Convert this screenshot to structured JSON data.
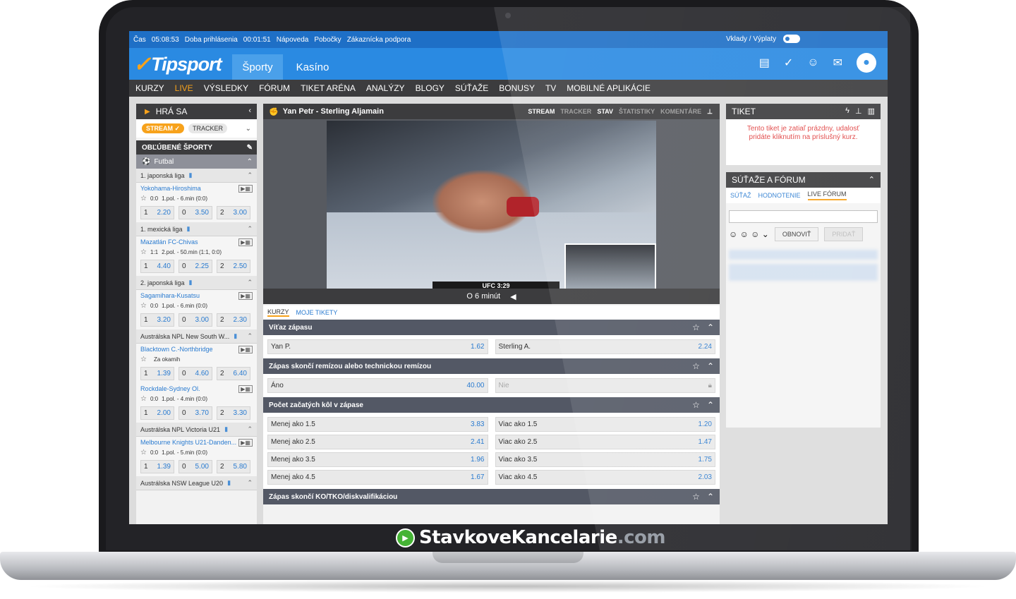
{
  "topbar": {
    "time_label": "Čas",
    "time": "05:08:53",
    "login_label": "Doba prihlásenia",
    "login_time": "00:01:51",
    "links": [
      "Nápoveda",
      "Pobočky",
      "Zákaznícka podpora"
    ],
    "deposits": "Vklady / Výplaty"
  },
  "header": {
    "logo": "Tipsport",
    "tabs": [
      "Športy",
      "Kasíno"
    ]
  },
  "nav": [
    "KURZY",
    "LIVE",
    "VÝSLEDKY",
    "FÓRUM",
    "TIKET ARÉNA",
    "ANALÝZY",
    "BLOGY",
    "SÚŤAŽE",
    "BONUSY",
    "TV",
    "MOBILNÉ APLIKÁCIE"
  ],
  "left": {
    "title": "HRÁ SA",
    "stream": "STREAM",
    "tracker": "TRACKER",
    "favorites": "OBĽÚBENÉ ŠPORTY",
    "sport": "Futbal",
    "leagues": [
      {
        "name": "1. japonská liga",
        "matches": [
          {
            "name": "Yokohama-Hiroshima",
            "score": "0:0",
            "status": "1.pol. - 6.min (0:0)",
            "odds": [
              [
                "1",
                "2.20"
              ],
              [
                "0",
                "3.50"
              ],
              [
                "2",
                "3.00"
              ]
            ]
          }
        ]
      },
      {
        "name": "1. mexická liga",
        "matches": [
          {
            "name": "Mazatlán FC-Chivas",
            "score": "1:1",
            "status": "2.pol. - 50.min (1:1, 0:0)",
            "odds": [
              [
                "1",
                "4.40"
              ],
              [
                "0",
                "2.25"
              ],
              [
                "2",
                "2.50"
              ]
            ]
          }
        ]
      },
      {
        "name": "2. japonská liga",
        "matches": [
          {
            "name": "Sagamihara-Kusatsu",
            "score": "0:0",
            "status": "1.pol. - 6.min (0:0)",
            "odds": [
              [
                "1",
                "3.20"
              ],
              [
                "0",
                "3.00"
              ],
              [
                "2",
                "2.30"
              ]
            ]
          }
        ]
      },
      {
        "name": "Austrálska NPL New South W...",
        "matches": [
          {
            "name": "Blacktown C.-Northbridge",
            "score": "",
            "status": "Za okamih",
            "odds": [
              [
                "1",
                "1.39"
              ],
              [
                "0",
                "4.60"
              ],
              [
                "2",
                "6.40"
              ]
            ]
          },
          {
            "name": "Rockdale-Sydney Ol.",
            "score": "0:0",
            "status": "1.pol. - 4.min (0:0)",
            "odds": [
              [
                "1",
                "2.00"
              ],
              [
                "0",
                "3.70"
              ],
              [
                "2",
                "3.30"
              ]
            ]
          }
        ]
      },
      {
        "name": "Austrálska NPL Victoria U21",
        "matches": [
          {
            "name": "Melbourne Knights U21-Danden...",
            "score": "0:0",
            "status": "1.pol. - 5.min (0:0)",
            "odds": [
              [
                "1",
                "1.39"
              ],
              [
                "0",
                "5.00"
              ],
              [
                "2",
                "5.80"
              ]
            ]
          }
        ]
      },
      {
        "name": "Austrálska NSW League U20",
        "matches": []
      }
    ]
  },
  "center": {
    "match_title": "Yan Petr - Sterling Aljamain",
    "tabs": [
      "STREAM",
      "TRACKER",
      "STAV",
      "ŠTATISTIKY",
      "KOMENTÁRE"
    ],
    "score_bar": "UFC 3:29",
    "video_status": "O 6 minút",
    "subtabs": [
      "KURZY",
      "MOJE TIKETY"
    ],
    "markets": [
      {
        "title": "Víťaz zápasu",
        "rows": [
          [
            [
              "Yan P.",
              "1.62"
            ],
            [
              "Sterling A.",
              "2.24"
            ]
          ]
        ]
      },
      {
        "title": "Zápas skončí remízou alebo technickou remízou",
        "rows": [
          [
            [
              "Áno",
              "40.00"
            ],
            [
              "Nie",
              ""
            ]
          ]
        ]
      },
      {
        "title": "Počet začatých kôl v zápase",
        "rows": [
          [
            [
              "Menej ako 1.5",
              "3.83"
            ],
            [
              "Viac ako 1.5",
              "1.20"
            ]
          ],
          [
            [
              "Menej ako 2.5",
              "2.41"
            ],
            [
              "Viac ako 2.5",
              "1.47"
            ]
          ],
          [
            [
              "Menej ako 3.5",
              "1.96"
            ],
            [
              "Viac ako 3.5",
              "1.75"
            ]
          ],
          [
            [
              "Menej ako 4.5",
              "1.67"
            ],
            [
              "Viac ako 4.5",
              "2.03"
            ]
          ]
        ]
      },
      {
        "title": "Zápas skončí KO/TKO/diskvalifikáciou",
        "rows": []
      }
    ]
  },
  "right": {
    "ticket_title": "TIKET",
    "ticket_msg": "Tento tiket je zatiaľ prázdny, udalosť pridáte kliknutím na príslušný kurz.",
    "forum_title": "SÚŤAŽE A FÓRUM",
    "forum_tabs": [
      "SÚŤAŽ",
      "HODNOTENIE",
      "LIVE FÓRUM"
    ],
    "refresh": "OBNOVIŤ",
    "add": "PRIDAŤ"
  },
  "watermark": {
    "name": "StavkoveKancelarie",
    "domain": ".com"
  }
}
